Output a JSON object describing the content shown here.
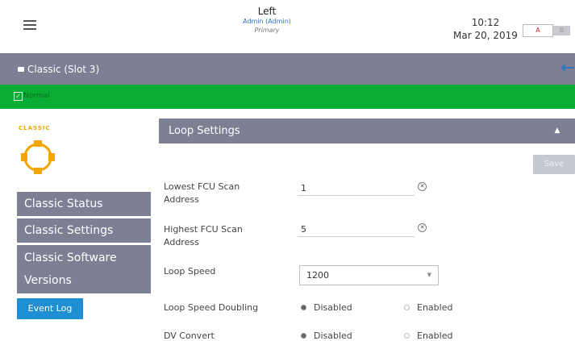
{
  "header": {
    "title": "Left",
    "user": "Admin (Admin)",
    "role": "Primary",
    "time": "10:12",
    "date": "Mar 20, 2019",
    "side_a": "A",
    "side_b": "B"
  },
  "slot_bar": {
    "title": "Classic (Slot 3)"
  },
  "status": {
    "label": "Normal",
    "check": "✓",
    "color": "#0bac34"
  },
  "logo": {
    "text": "CLASSIC"
  },
  "nav": {
    "items": [
      {
        "label": "Classic Status"
      },
      {
        "label": "Classic Settings"
      },
      {
        "label": "Classic Software Versions"
      }
    ],
    "event_log": "Event Log"
  },
  "settings": {
    "title": "Loop Settings",
    "save_label": "Save",
    "lowest_fcu": {
      "label": "Lowest FCU Scan Address",
      "value": "1"
    },
    "highest_fcu": {
      "label": "Highest FCU Scan Address",
      "value": "5"
    },
    "loop_speed": {
      "label": "Loop Speed",
      "value": "1200"
    },
    "loop_speed_doubling": {
      "label": "Loop Speed Doubling",
      "options": [
        "Disabled",
        "Enabled"
      ],
      "selected": "Disabled"
    },
    "dv_convert": {
      "label": "DV Convert",
      "options": [
        "Disabled",
        "Enabled"
      ],
      "selected": "Disabled"
    }
  },
  "colors": {
    "accent_bar": "#7d7f95",
    "event_log": "#1e8fd2",
    "logo": "#f2a400"
  }
}
